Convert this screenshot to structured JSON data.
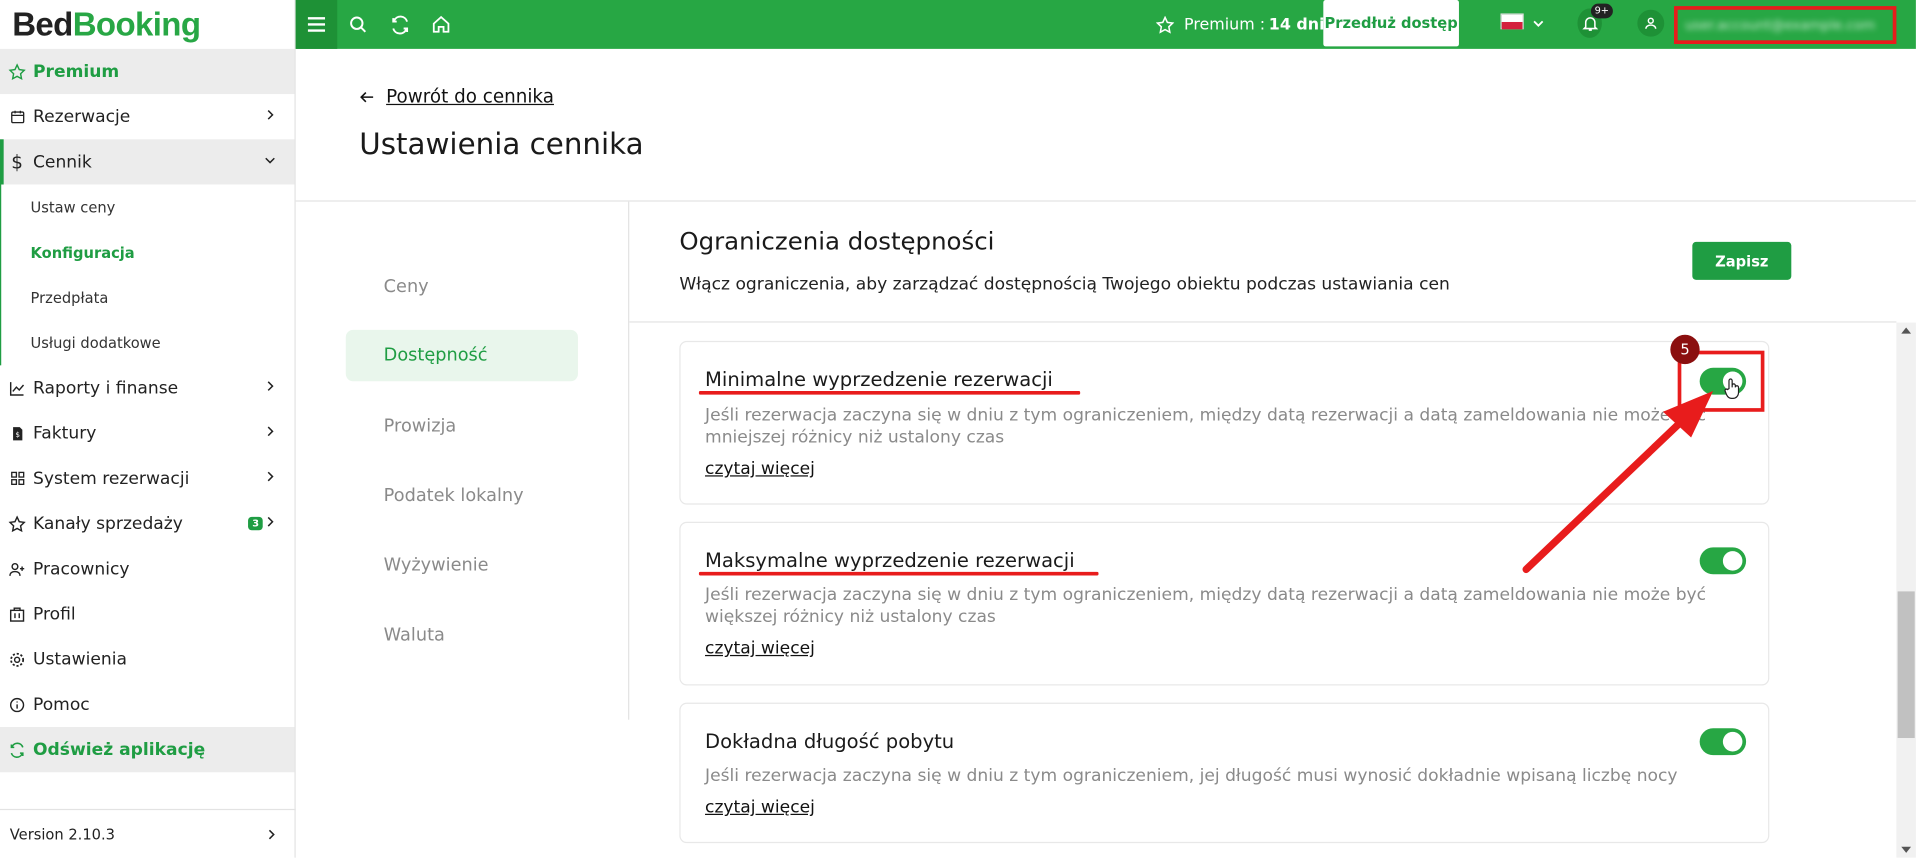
{
  "app": {
    "logo_part1": "Bed",
    "logo_part2": "Booking"
  },
  "sidebar": {
    "premium": "Premium",
    "items": [
      {
        "label": "Rezerwacje"
      },
      {
        "label": "Cennik"
      },
      {
        "label": "Raporty i finanse"
      },
      {
        "label": "Faktury"
      },
      {
        "label": "System rezerwacji"
      },
      {
        "label": "Kanały sprzedaży",
        "badge": "3"
      },
      {
        "label": "Pracownicy"
      },
      {
        "label": "Profil"
      },
      {
        "label": "Ustawienia"
      },
      {
        "label": "Pomoc"
      }
    ],
    "subitems": [
      "Ustaw ceny",
      "Konfiguracja",
      "Przedpłata",
      "Usługi dodatkowe"
    ],
    "refresh": "Odśwież aplikację",
    "version": "Version 2.10.3"
  },
  "topbar": {
    "premium_label": "Premium :",
    "premium_days": "14 dni",
    "extend_button": "Przedłuż dostęp",
    "notif_badge": "9+",
    "user_email": "user.account@example.com"
  },
  "page": {
    "back_link": "Powrót do cennika",
    "title": "Ustawienia cennika"
  },
  "tabs": [
    "Ceny",
    "Dostępność",
    "Prowizja",
    "Podatek lokalny",
    "Wyżywienie",
    "Waluta"
  ],
  "section": {
    "title": "Ograniczenia dostępności",
    "subtitle": "Włącz ograniczenia, aby zarządzać dostępnością Twojego obiektu podczas ustawiania cen",
    "save_button": "Zapisz"
  },
  "cards": [
    {
      "title": "Minimalne wyprzedzenie rezerwacji",
      "desc": "Jeśli rezerwacja zaczyna się w dniu z tym ograniczeniem, między datą rezerwacji a datą zameldowania nie może być mniejszej różnicy niż ustalony czas",
      "link": "czytaj więcej",
      "enabled": true
    },
    {
      "title": "Maksymalne wyprzedzenie rezerwacji",
      "desc": "Jeśli rezerwacja zaczyna się w dniu z tym ograniczeniem, między datą rezerwacji a datą zameldowania nie może być większej różnicy niż ustalony czas",
      "link": "czytaj więcej",
      "enabled": true
    },
    {
      "title": "Dokładna długość pobytu",
      "desc": "Jeśli rezerwacja zaczyna się w dniu z tym ograniczeniem, jej długość musi wynosić dokładnie wpisaną liczbę nocy",
      "link": "czytaj więcej",
      "enabled": true
    }
  ],
  "annotation": {
    "step": "5",
    "color": "#e81c1c"
  },
  "colors": {
    "brand": "#27a744",
    "accent_dark": "#1e9136"
  }
}
